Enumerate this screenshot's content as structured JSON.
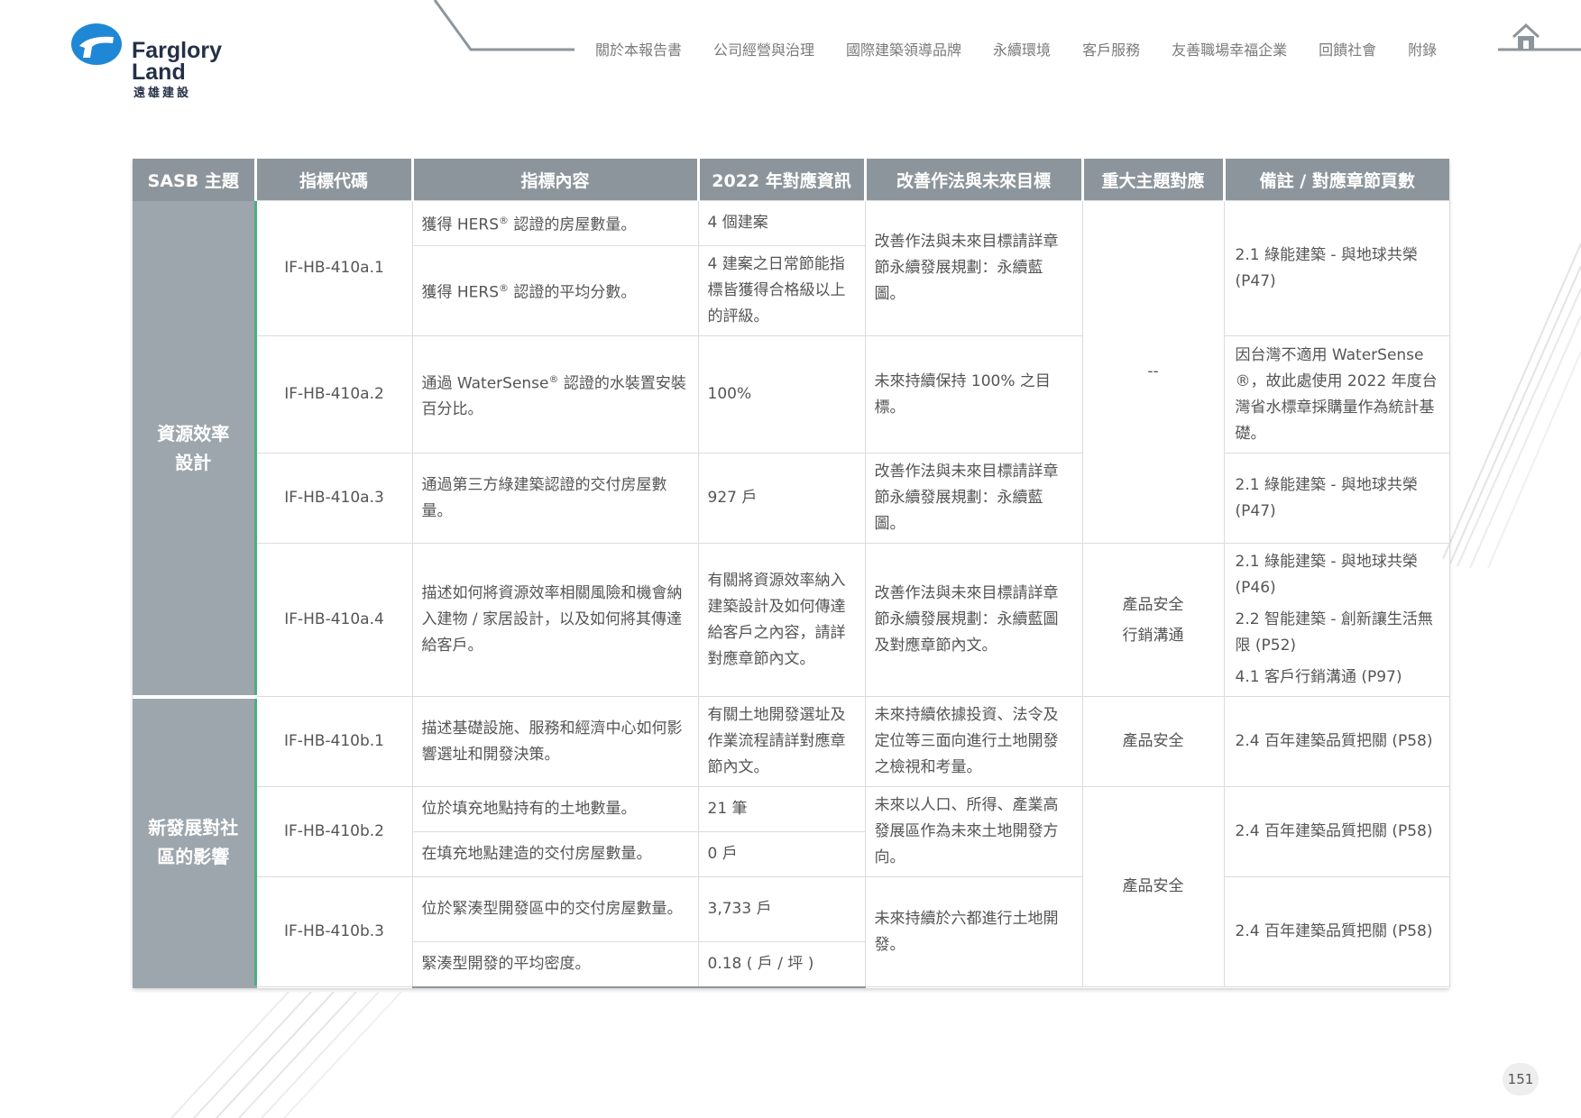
{
  "logo": {
    "en_line1": "Farglory",
    "en_line2": "Land",
    "zh": "遠雄建設"
  },
  "nav": [
    "關於本報告書",
    "公司經營與治理",
    "國際建築領導品牌",
    "永續環境",
    "客戶服務",
    "友善職場幸福企業",
    "回饋社會",
    "附錄"
  ],
  "table": {
    "headers": [
      "SASB 主題",
      "指標代碼",
      "指標內容",
      "2022 年對應資訊",
      "改善作法與未來目標",
      "重大主題對應",
      "備註 / 對應章節頁數"
    ],
    "topics": [
      "資源效率設計",
      "新發展對社區的影響"
    ],
    "codes": [
      "IF-HB-410a.1",
      "IF-HB-410a.2",
      "IF-HB-410a.3",
      "IF-HB-410a.4",
      "IF-HB-410b.1",
      "IF-HB-410b.2",
      "IF-HB-410b.3"
    ],
    "contents": {
      "a1_1_pre": "獲得 HERS",
      "a1_1_post": " 認證的房屋數量。",
      "a1_2_pre": "獲得 HERS",
      "a1_2_post": " 認證的平均分數。",
      "a2_pre": "通過 WaterSense",
      "a2_post": " 認證的水裝置安裝百分比。",
      "a3": "通過第三方綠建築認證的交付房屋數量。",
      "a4": "描述如何將資源效率相關風險和機會納入建物 / 家居設計，以及如何將其傳達給客戶。",
      "b1": "描述基礎設施、服務和經濟中心如何影響選址和開發決策。",
      "b2_1": "位於填充地點持有的土地數量。",
      "b2_2": "在填充地點建造的交付房屋數量。",
      "b3_1": "位於緊湊型開發區中的交付房屋數量。",
      "b3_2": "緊湊型開發的平均密度。"
    },
    "info": {
      "a1_1": "4 個建案",
      "a1_2": "4 建案之日常節能指標皆獲得合格級以上的評級。",
      "a2": "100%",
      "a3": "927 戶",
      "a4": "有關將資源效率納入建築設計及如何傳達給客戶之內容，請詳對應章節內文。",
      "b1": "有關土地開發選址及作業流程請詳對應章節內文。",
      "b2_1": "21 筆",
      "b2_2": "0 戶",
      "b3_1": "3,733 戶",
      "b3_2": "0.18 ( 戶 / 坪 )"
    },
    "improve": {
      "a1": "改善作法與未來目標請詳章節永續發展規劃：永續藍圖。",
      "a2": "未來持續保持 100% 之目標。",
      "a3": "改善作法與未來目標請詳章節永續發展規劃：永續藍圖。",
      "a4": "改善作法與未來目標請詳章節永續發展規劃：永續藍圖及對應章節內文。",
      "b1": "未來持續依據投資、法令及定位等三面向進行土地開發之檢視和考量。",
      "b2": "未來以人口、所得、產業高發展區作為未來土地開發方向。",
      "b3": "未來持續於六都進行土地開發。"
    },
    "material": {
      "a1_a3": "--",
      "a4_1": "產品安全",
      "a4_2": "行銷溝通",
      "b1": "產品安全",
      "b2_b3": "產品安全"
    },
    "notes": {
      "a1": "2.1 綠能建築 - 與地球共榮 (P47)",
      "a2_pre": "因台灣不適用 WaterSense",
      "a2_post": "，故此處使用 2022 年度台灣省水標章採購量作為統計基礎。",
      "a3": "2.1 綠能建築 - 與地球共榮 (P47)",
      "a4_1": "2.1 綠能建築 - 與地球共榮 (P46)",
      "a4_2": "2.2 智能建築 - 創新讓生活無限 (P52)",
      "a4_3": "4.1 客戶行銷溝通 (P97)",
      "b1": "2.4 百年建築品質把關 (P58)",
      "b2": "2.4 百年建築品質把關 (P58)",
      "b3": "2.4 百年建築品質把關 (P58)"
    },
    "reg_mark": "®"
  },
  "page_number": "151",
  "colors": {
    "header_bg": "#8d959c",
    "topic_bg": "#9da6ad",
    "accent_green": "#4caf82",
    "logo_blue": "#1e88d6",
    "logo_navy": "#253047"
  },
  "icons": {
    "home": "home-icon",
    "logo": "farglory-logo-mark"
  }
}
